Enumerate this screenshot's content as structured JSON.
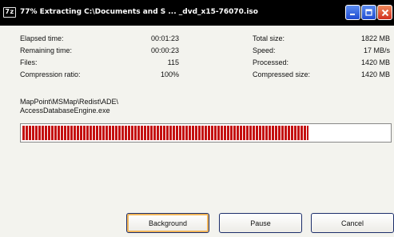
{
  "titlebar": {
    "icon_text": "7z",
    "title": "77% Extracting C:\\Documents and S ... _dvd_x15-76070.iso"
  },
  "stats": {
    "elapsed_label": "Elapsed time:",
    "elapsed_value": "00:01:23",
    "remaining_label": "Remaining time:",
    "remaining_value": "00:00:23",
    "files_label": "Files:",
    "files_value": "115",
    "ratio_label": "Compression ratio:",
    "ratio_value": "100%",
    "total_label": "Total size:",
    "total_value": "1822 MB",
    "speed_label": "Speed:",
    "speed_value": "17 MB/s",
    "processed_label": "Processed:",
    "processed_value": "1420 MB",
    "compressed_label": "Compressed size:",
    "compressed_value": "1420 MB"
  },
  "current_file": {
    "line1": "MapPoint\\MSMap\\Redist\\ADE\\",
    "line2": "AccessDatabaseEngine.exe"
  },
  "progress": {
    "fraction": 0.78,
    "fill_color": "#c41010"
  },
  "buttons": {
    "background": "Background",
    "pause": "Pause",
    "cancel": "Cancel"
  },
  "colors": {
    "titlebar": "#000000",
    "close_button": "#d12f1f",
    "button_border": "#1d2f6b",
    "focus_ring": "#f1b65b"
  }
}
